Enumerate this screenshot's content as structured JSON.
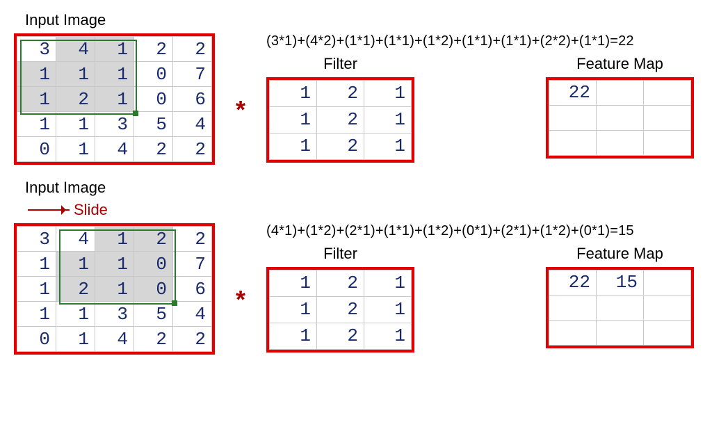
{
  "accent": "#e30000",
  "labels": {
    "input": "Input Image",
    "slide": "Slide",
    "filter": "Filter",
    "feature": "Feature Map",
    "conv": "*"
  },
  "input_image": {
    "rows": [
      [
        3,
        4,
        1,
        2,
        2
      ],
      [
        1,
        1,
        1,
        0,
        7
      ],
      [
        1,
        2,
        1,
        0,
        6
      ],
      [
        1,
        1,
        3,
        5,
        4
      ],
      [
        0,
        1,
        4,
        2,
        2
      ]
    ]
  },
  "filter": {
    "rows": [
      [
        1,
        2,
        1
      ],
      [
        1,
        2,
        1
      ],
      [
        1,
        2,
        1
      ]
    ]
  },
  "step1": {
    "equation": "(3*1)+(4*2)+(1*1)+(1*1)+(1*2)+(1*1)+(1*1)+(2*2)+(1*1)=22",
    "window_col_start": 0,
    "feature_map": {
      "rows": [
        [
          "22",
          "",
          ""
        ],
        [
          "",
          "",
          ""
        ],
        [
          "",
          "",
          ""
        ]
      ]
    }
  },
  "step2": {
    "equation": "(4*1)+(1*2)+(2*1)+(1*1)+(1*2)+(0*1)+(2*1)+(1*2)+(0*1)=15",
    "window_col_start": 1,
    "feature_map": {
      "rows": [
        [
          "22",
          "15",
          ""
        ],
        [
          "",
          "",
          ""
        ],
        [
          "",
          "",
          ""
        ]
      ]
    }
  },
  "chart_data": {
    "type": "table",
    "description": "Illustration of 2D convolution (cross-correlation) of a 5x5 input with a 3x3 filter, sliding horizontally, producing a 3x3 feature map.",
    "input": [
      [
        3,
        4,
        1,
        2,
        2
      ],
      [
        1,
        1,
        1,
        0,
        7
      ],
      [
        1,
        2,
        1,
        0,
        6
      ],
      [
        1,
        1,
        3,
        5,
        4
      ],
      [
        0,
        1,
        4,
        2,
        2
      ]
    ],
    "filter": [
      [
        1,
        2,
        1
      ],
      [
        1,
        2,
        1
      ],
      [
        1,
        2,
        1
      ]
    ],
    "feature_map_shape": [
      3,
      3
    ],
    "steps": [
      {
        "window_top_left": [
          0,
          0
        ],
        "result": 22,
        "expr": "(3*1)+(4*2)+(1*1)+(1*1)+(1*2)+(1*1)+(1*1)+(2*2)+(1*1)=22"
      },
      {
        "window_top_left": [
          0,
          1
        ],
        "result": 15,
        "expr": "(4*1)+(1*2)+(2*1)+(1*1)+(1*2)+(0*1)+(2*1)+(1*2)+(0*1)=15"
      }
    ]
  }
}
